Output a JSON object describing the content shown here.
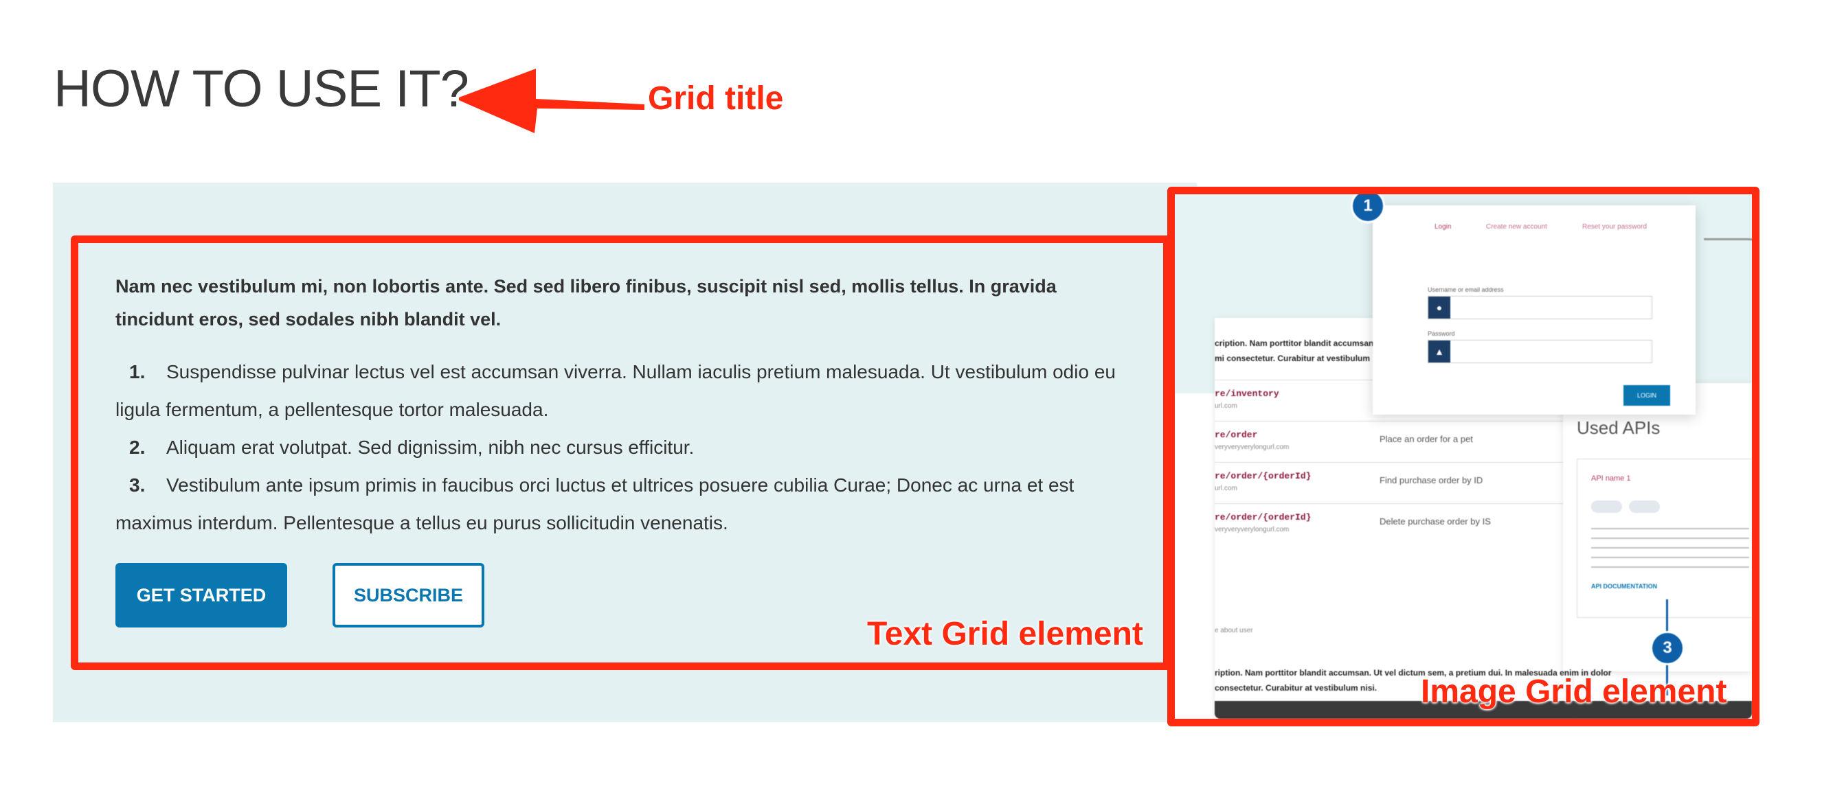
{
  "page": {
    "title": "HOW TO USE IT?"
  },
  "annotations": {
    "grid_title": "Grid title",
    "text_grid": "Text Grid element",
    "image_grid": "Image Grid element"
  },
  "text_grid": {
    "intro": "Nam nec vestibulum mi, non lobortis ante. Sed sed libero finibus, suscipit nisl sed, mollis tellus. In gravida tincidunt eros, sed sodales nibh blandit vel.",
    "steps": [
      {
        "num": "1.",
        "text": "Suspendisse pulvinar lectus vel est accumsan viverra. Nullam iaculis pretium malesuada. Ut vestibulum odio eu ligula fermentum, a pellentesque tortor malesuada."
      },
      {
        "num": "2.",
        "text": "Aliquam erat volutpat. Sed dignissim, nibh nec cursus efficitur."
      },
      {
        "num": "3.",
        "text": "Vestibulum ante ipsum primis in faucibus orci luctus et ultrices posuere cubilia Curae; Donec ac urna et est maximus interdum. Pellentesque a tellus eu purus sollicitudin venenatis."
      }
    ],
    "buttons": {
      "primary": "GET STARTED",
      "secondary": "SUBSCRIBE"
    }
  },
  "image_grid": {
    "mock": {
      "tabs": [
        "Login",
        "Create new account",
        "Reset your password"
      ],
      "username_label": "Username or email address",
      "password_label": "Password",
      "login_button": "LOGIN",
      "badge_1": "1",
      "badge_3": "3",
      "desc_top": "cription. Nam porttitor blandit accumsan",
      "desc_top_2": "mi consectetur. Curabitur at vestibulum",
      "rows": [
        {
          "path": "re/inventory",
          "sub": "url.com",
          "desc": ""
        },
        {
          "path": "re/order",
          "sub": "veryveryverylongurl.com",
          "desc": "Place an order for a pet"
        },
        {
          "path": "re/order/{orderId}",
          "sub": "url.com",
          "desc": "Find purchase order by ID"
        },
        {
          "path": "re/order/{orderId}",
          "sub": "veryveryverylongurl.com",
          "desc": "Delete purchase order by IS"
        }
      ],
      "about": "e about user",
      "used_apis": "Used APIs",
      "api_name": "API name 1",
      "api_link": "API DOCUMENTATION",
      "desc_bottom": "ription. Nam porttitor blandit accumsan. Ut vel dictum sem, a pretium dui. In malesuada enim in dolor",
      "desc_bottom_2": "consectetur. Curabitur at vestibulum nisi."
    }
  },
  "colors": {
    "accent": "#0a77b0",
    "annotation": "#ff2a10",
    "grid_background": "#e3f1f2",
    "title": "#3a3a3a"
  }
}
